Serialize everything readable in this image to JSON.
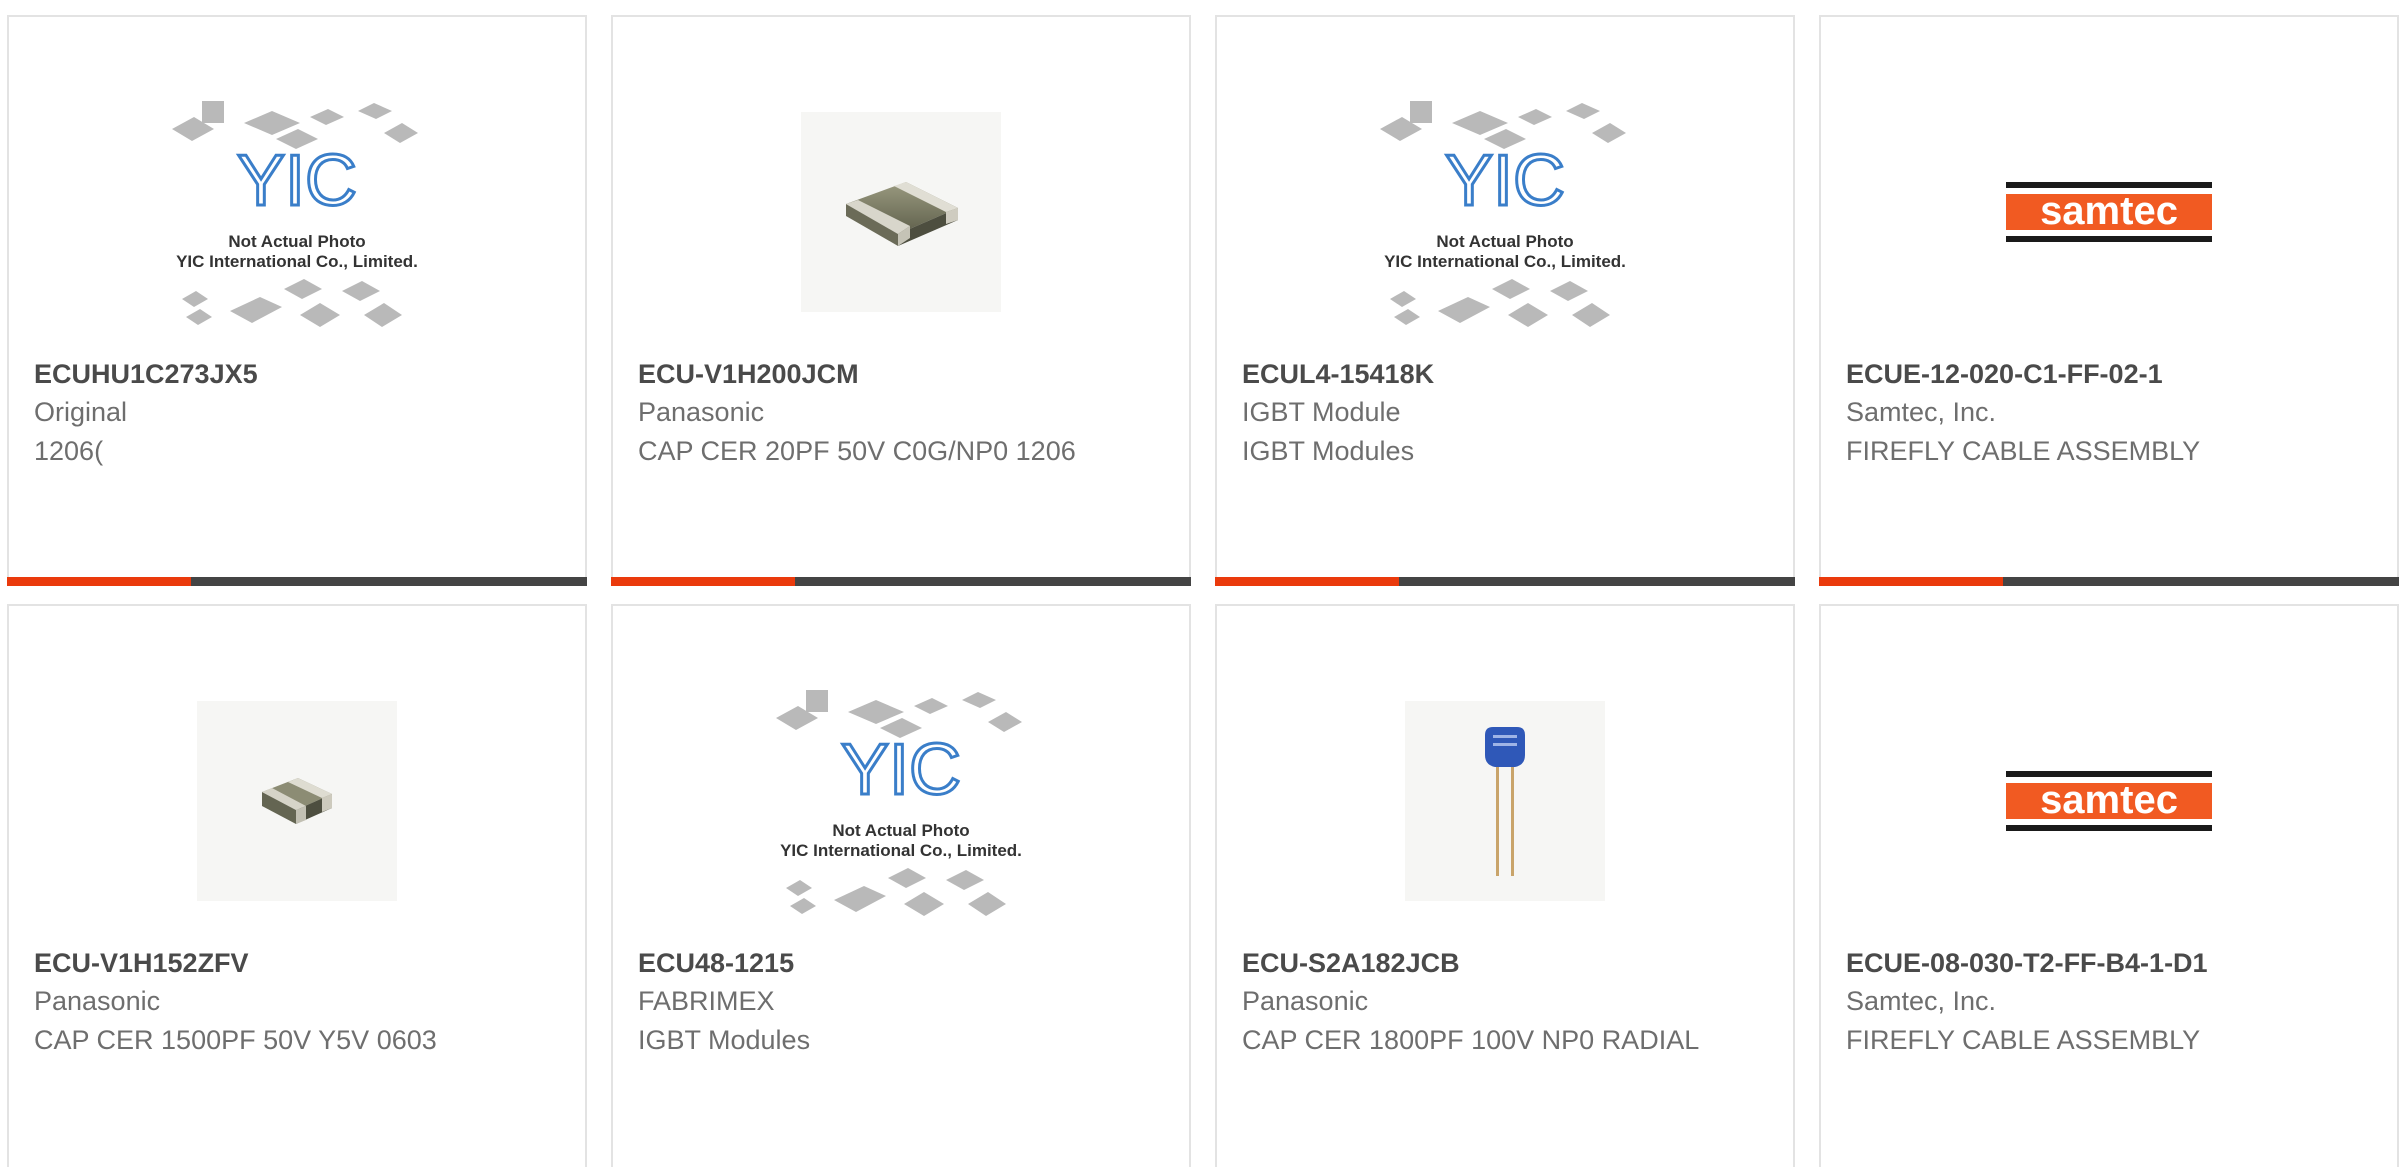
{
  "placeholder": {
    "line1": "Not Actual Photo",
    "line2": "YIC International Co., Limited.",
    "logo": "YIC"
  },
  "samtec_logo": "samtec",
  "colors": {
    "accent": "#ea3a0c",
    "bar": "#444444",
    "border": "#e3e3e3",
    "samtec": "#f15a22"
  },
  "products": [
    {
      "part_number": "ECUHU1C273JX5",
      "manufacturer": "Original",
      "description": "1206(",
      "image": "yic-placeholder"
    },
    {
      "part_number": "ECU-V1H200JCM",
      "manufacturer": "Panasonic",
      "description": "CAP CER 20PF 50V C0G/NP0 1206",
      "image": "chip-capacitor-1206"
    },
    {
      "part_number": "ECUL4-15418K",
      "manufacturer": "IGBT Module",
      "description": "IGBT Modules",
      "image": "yic-placeholder"
    },
    {
      "part_number": "ECUE-12-020-C1-FF-02-1",
      "manufacturer": "Samtec, Inc.",
      "description": "FIREFLY CABLE ASSEMBLY",
      "image": "samtec-logo"
    },
    {
      "part_number": "ECU-V1H152ZFV",
      "manufacturer": "Panasonic",
      "description": "CAP CER 1500PF 50V Y5V 0603",
      "image": "chip-capacitor-0603"
    },
    {
      "part_number": "ECU48-1215",
      "manufacturer": "FABRIMEX",
      "description": "IGBT Modules",
      "image": "yic-placeholder"
    },
    {
      "part_number": "ECU-S2A182JCB",
      "manufacturer": "Panasonic",
      "description": "CAP CER 1800PF 100V NP0 RADIAL",
      "image": "radial-capacitor"
    },
    {
      "part_number": "ECUE-08-030-T2-FF-B4-1-D1",
      "manufacturer": "Samtec, Inc.",
      "description": "FIREFLY CABLE ASSEMBLY",
      "image": "samtec-logo"
    }
  ]
}
